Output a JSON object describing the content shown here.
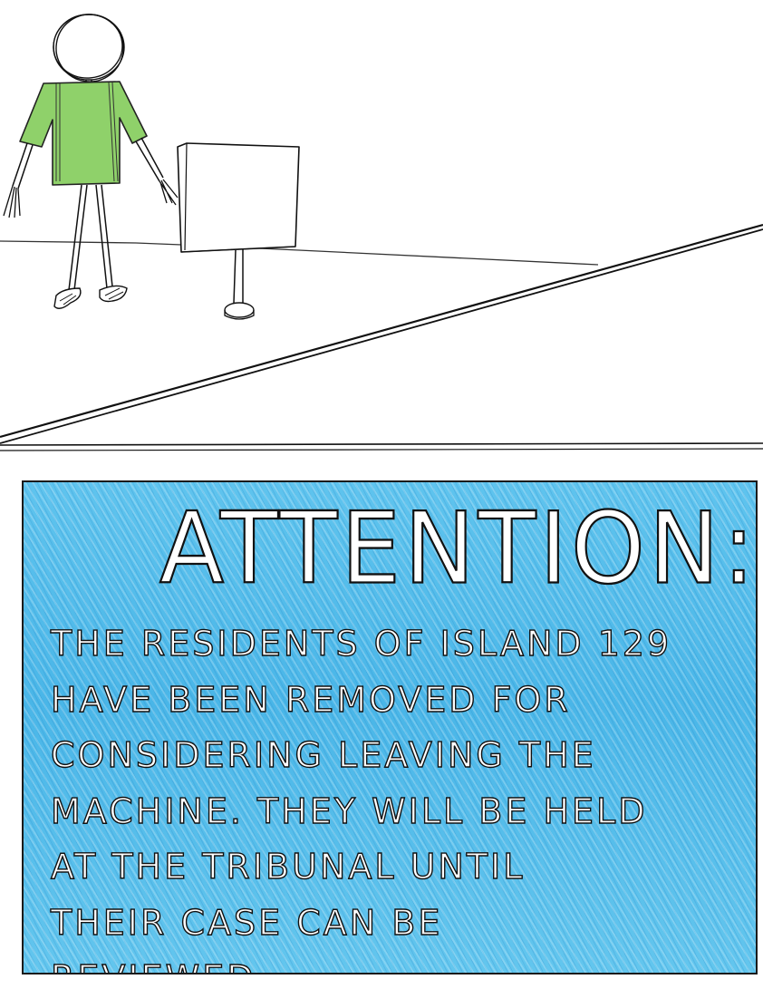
{
  "notice": {
    "title": "ATTENTION:",
    "lines": [
      "THE RESIDENTS OF ISLAND 129",
      "HAVE BEEN REMOVED FOR",
      "CONSIDERING LEAVING THE",
      "MACHINE. THEY WILL BE HELD",
      "AT THE TRIBUNAL UNTIL",
      "THEIR CASE CAN BE",
      "REVIEWED."
    ]
  },
  "colors": {
    "notice_background": "#4db8e8",
    "shirt": "#8fd16a",
    "ink": "#111111"
  }
}
